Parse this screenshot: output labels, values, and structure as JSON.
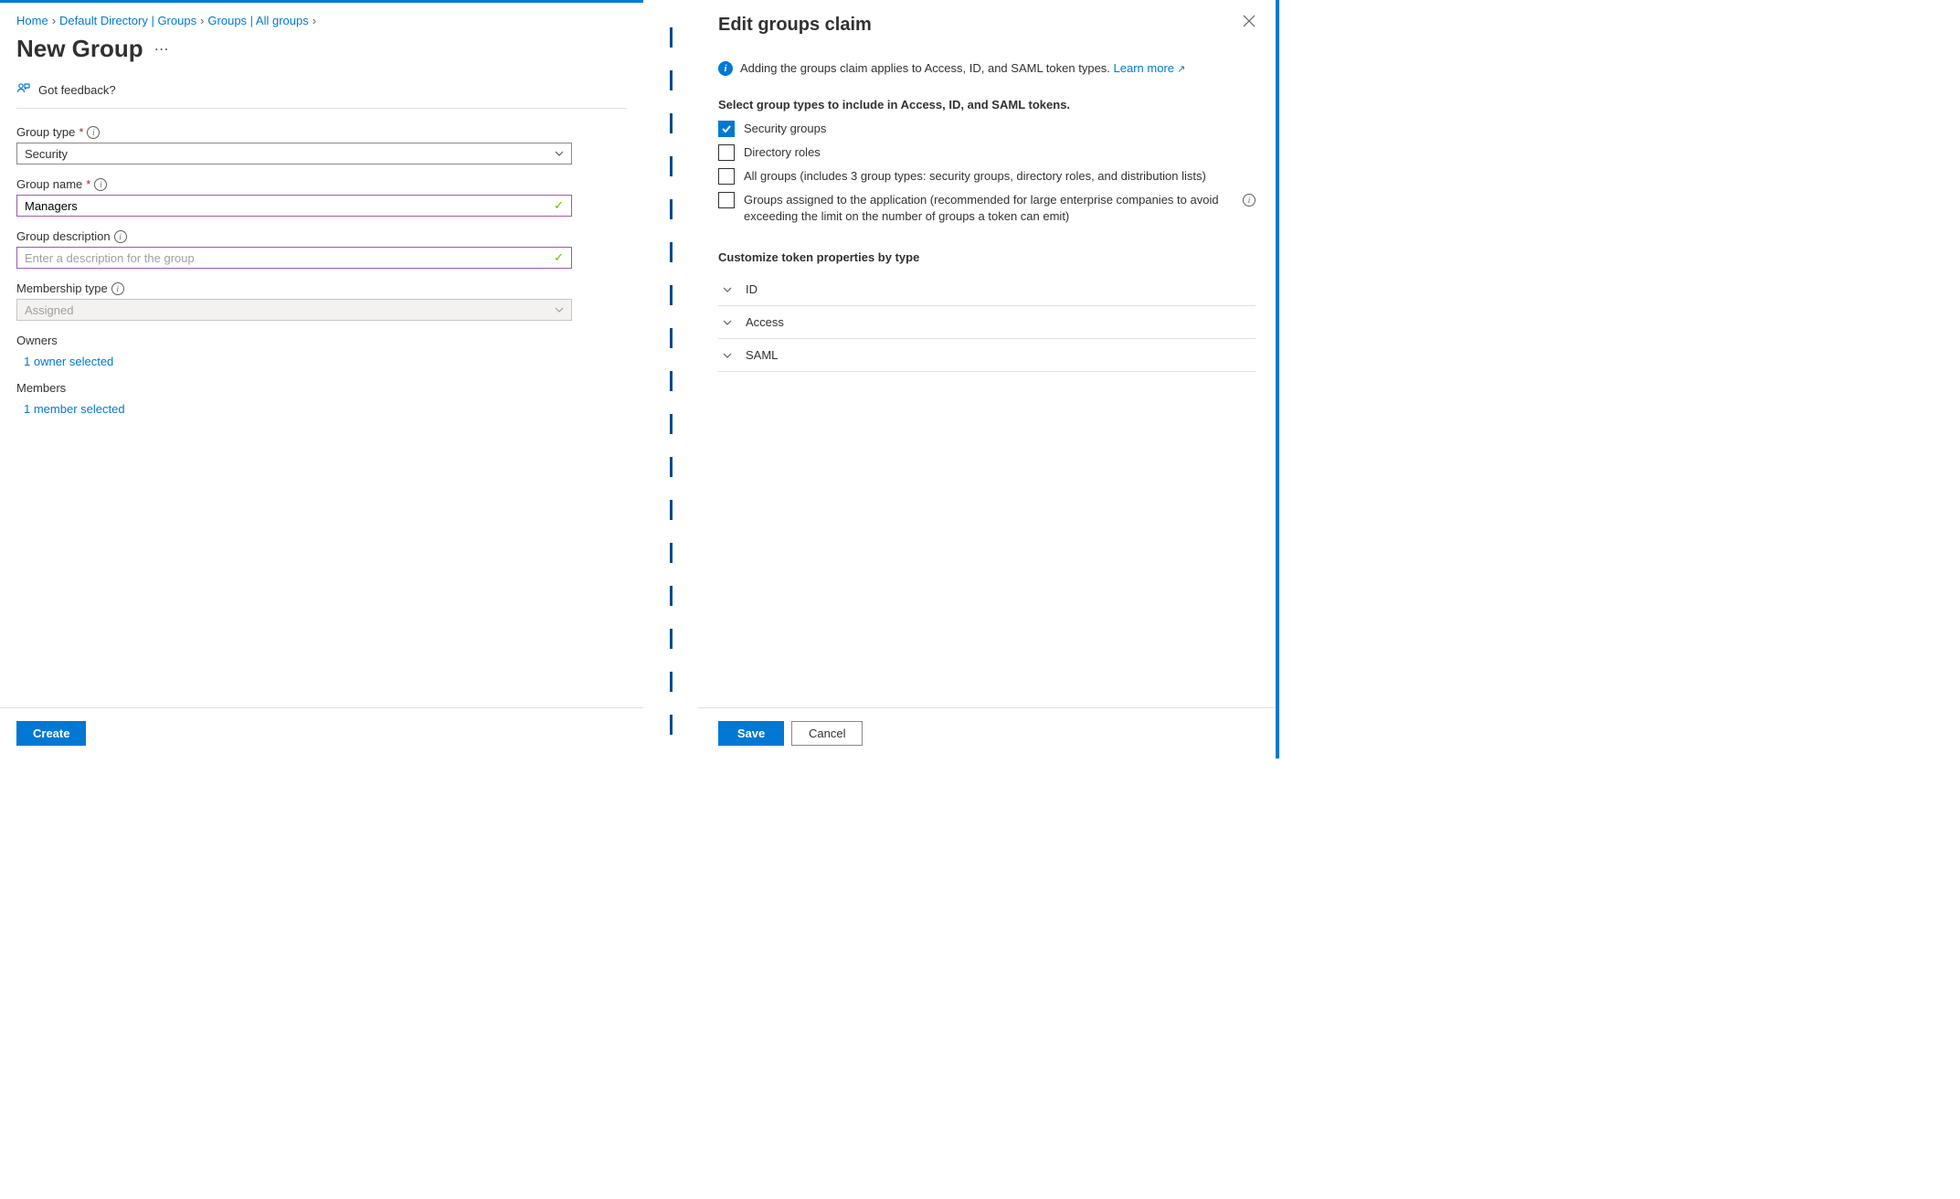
{
  "left": {
    "breadcrumb": [
      "Home",
      "Default Directory | Groups",
      "Groups | All groups"
    ],
    "page_title": "New Group",
    "feedback": "Got feedback?",
    "fields": {
      "group_type": {
        "label": "Group type",
        "value": "Security"
      },
      "group_name": {
        "label": "Group name",
        "value": "Managers"
      },
      "group_description": {
        "label": "Group description",
        "value": "",
        "placeholder": "Enter a description for the group"
      },
      "membership_type": {
        "label": "Membership type",
        "value": "Assigned"
      }
    },
    "owners": {
      "label": "Owners",
      "link": "1 owner selected"
    },
    "members": {
      "label": "Members",
      "link": "1 member selected"
    },
    "create_button": "Create"
  },
  "right": {
    "title": "Edit groups claim",
    "info_text": "Adding the groups claim applies to Access, ID, and SAML token types.",
    "learn_more": "Learn more",
    "select_heading": "Select group types to include in Access, ID, and SAML tokens.",
    "checkboxes": [
      {
        "label": "Security groups",
        "checked": true
      },
      {
        "label": "Directory roles",
        "checked": false
      },
      {
        "label": "All groups (includes 3 group types: security groups, directory roles, and distribution lists)",
        "checked": false
      },
      {
        "label": "Groups assigned to the application (recommended for large enterprise companies to avoid exceeding the limit on the number of groups a token can emit)",
        "checked": false,
        "info": true
      }
    ],
    "customize_heading": "Customize token properties by type",
    "expand_items": [
      "ID",
      "Access",
      "SAML"
    ],
    "save_button": "Save",
    "cancel_button": "Cancel"
  }
}
